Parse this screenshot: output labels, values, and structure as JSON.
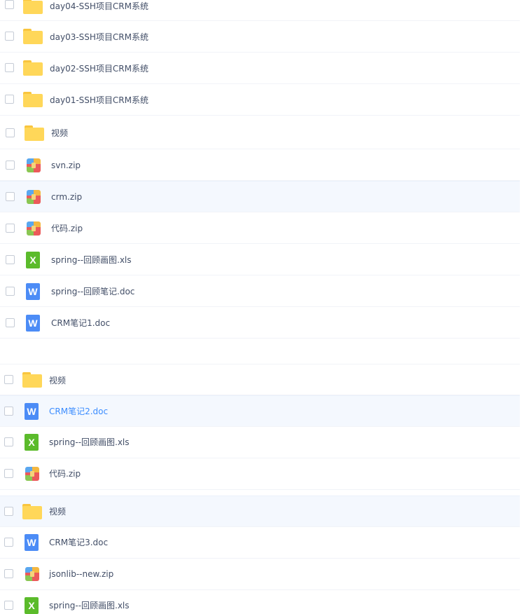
{
  "files": [
    {
      "name": "day04-SSH项目CRM系统",
      "type": "folder",
      "icon": "folder-icon"
    },
    {
      "name": "day03-SSH项目CRM系统",
      "type": "folder",
      "icon": "folder-icon"
    },
    {
      "name": "day02-SSH项目CRM系统",
      "type": "folder",
      "icon": "folder-icon"
    },
    {
      "name": "day01-SSH项目CRM系统",
      "type": "folder",
      "icon": "folder-icon"
    },
    {
      "name": "视频",
      "type": "folder",
      "icon": "folder-icon"
    },
    {
      "name": "svn.zip",
      "type": "zip",
      "icon": "zip-archive-icon"
    },
    {
      "name": "crm.zip",
      "type": "zip",
      "icon": "zip-archive-icon"
    },
    {
      "name": "代码.zip",
      "type": "zip",
      "icon": "zip-archive-icon"
    },
    {
      "name": "spring--回顾画图.xls",
      "type": "excel",
      "icon": "excel-file-icon"
    },
    {
      "name": "spring--回顾笔记.doc",
      "type": "word",
      "icon": "word-file-icon"
    },
    {
      "name": "CRM笔记1.doc",
      "type": "word",
      "icon": "word-file-icon"
    },
    {
      "name": "视频",
      "type": "folder",
      "icon": "folder-icon"
    },
    {
      "name": "CRM笔记2.doc",
      "type": "word",
      "icon": "word-file-icon"
    },
    {
      "name": "spring--回顾画图.xls",
      "type": "excel",
      "icon": "excel-file-icon"
    },
    {
      "name": "代码.zip",
      "type": "zip",
      "icon": "zip-archive-icon"
    },
    {
      "name": "视频",
      "type": "folder",
      "icon": "folder-icon"
    },
    {
      "name": "CRM笔记3.doc",
      "type": "word",
      "icon": "word-file-icon"
    },
    {
      "name": "jsonlib--new.zip",
      "type": "zip",
      "icon": "zip-archive-icon"
    },
    {
      "name": "spring--回顾画图.xls",
      "type": "excel",
      "icon": "excel-file-icon"
    }
  ],
  "icon_glyphs": {
    "word": "W",
    "excel": "X"
  },
  "colors": {
    "folder": "#ffd759",
    "word": "#4c8cf6",
    "excel": "#5bbb2b",
    "link_text": "#3b8cff",
    "hover_row": "#f4f8fe"
  }
}
